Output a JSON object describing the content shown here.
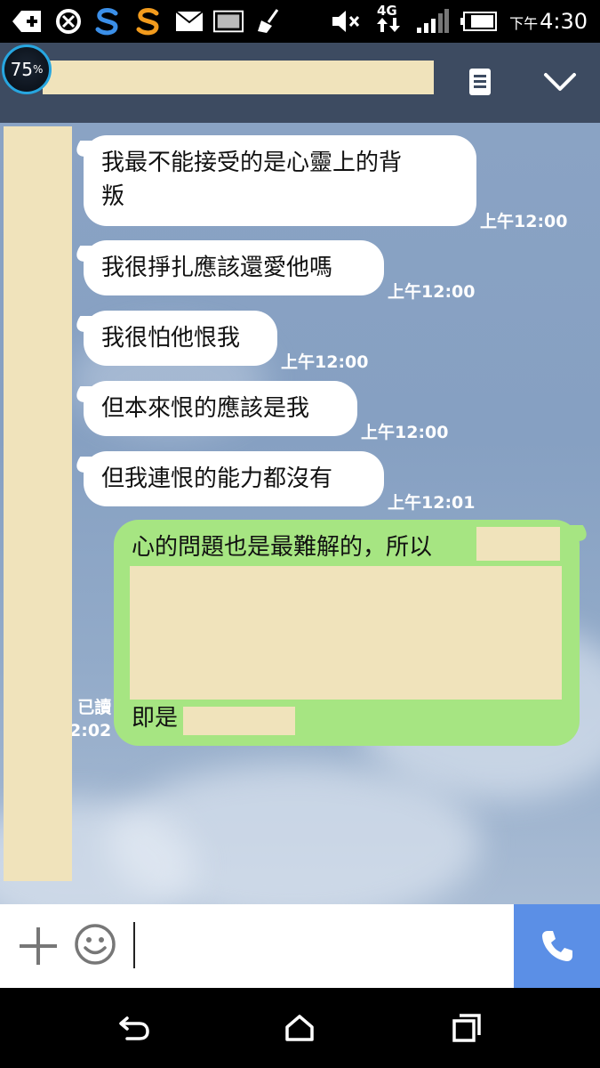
{
  "status_bar": {
    "time_prefix": "下午",
    "time": "4:30",
    "network": "4G",
    "icons": [
      "add-icon",
      "sync-icon",
      "app-s-blue-icon",
      "app-s-orange-icon",
      "mail-icon",
      "image-icon",
      "broom-icon",
      "mute-icon",
      "network-4g-icon",
      "signal-icon",
      "battery-icon"
    ]
  },
  "header": {
    "battery_percent": "75",
    "battery_unit": "%",
    "menu_icon": "notes-icon",
    "collapse_icon": "chevron-down-icon"
  },
  "messages_in": [
    {
      "lines": [
        "我最不能接受的是心靈上的背",
        "叛"
      ],
      "time": "上午12:00"
    },
    {
      "lines": [
        "我很掙扎應該還愛他嗎"
      ],
      "time": "上午12:00"
    },
    {
      "lines": [
        "我很怕他恨我"
      ],
      "time": "上午12:00"
    },
    {
      "lines": [
        "但本來恨的應該是我"
      ],
      "time": "上午12:00"
    },
    {
      "lines": [
        "但我連恨的能力都沒有"
      ],
      "time": "上午12:01"
    }
  ],
  "message_out": {
    "line1": "心的問題也是最難解的，所以",
    "line_last": "即是",
    "read_label": "已讀",
    "read_time": "2:02"
  },
  "input_bar": {
    "add_icon": "plus-icon",
    "emoji_icon": "smiley-icon",
    "call_icon": "phone-icon"
  },
  "nav_bar": {
    "icons": [
      "back-icon",
      "home-icon",
      "recents-icon"
    ]
  },
  "colors": {
    "header": "#3d4b61",
    "outgoing_bubble": "#a6e582",
    "call_button": "#5b8fe6",
    "redaction": "#f0e3bb"
  }
}
